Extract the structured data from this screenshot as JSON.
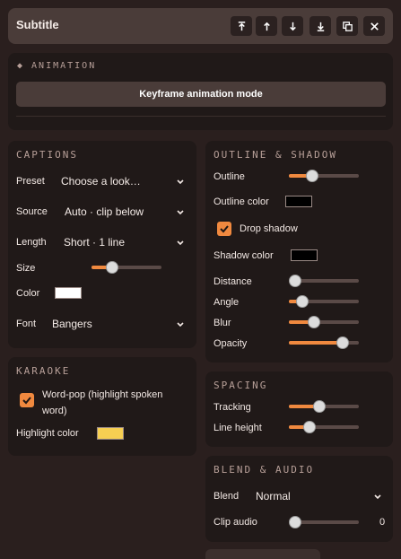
{
  "header": {
    "title": "Subtitle",
    "buttons": [
      "move-to-top-icon",
      "move-up-icon",
      "move-down-icon",
      "move-to-bottom-icon",
      "duplicate-icon",
      "close-icon"
    ]
  },
  "animation": {
    "title": "◆ ANIMATION",
    "button_label": "Keyframe animation mode"
  },
  "captions": {
    "title": "CAPTIONS",
    "preset_label": "Preset",
    "preset_value": "Choose a look…",
    "source_label": "Source",
    "source_value": "Auto · clip below",
    "length_label": "Length",
    "length_value": "Short · 1 line",
    "size_label": "Size",
    "size_level": 0.3,
    "color_label": "Color",
    "color_value": "#ffffff",
    "font_label": "Font",
    "font_value": "Bangers"
  },
  "karaoke": {
    "title": "KARAOKE",
    "wordpop_label": "Word-pop (highlight spoken word)",
    "wordpop_checked": true,
    "highlight_label": "Highlight color",
    "highlight_color": "#f6cf52"
  },
  "outline_shadow": {
    "title": "OUTLINE & SHADOW",
    "outline_label": "Outline",
    "outline_level": 0.33,
    "outline_color_label": "Outline color",
    "outline_color": "#000000",
    "drop_shadow_label": "Drop shadow",
    "drop_shadow_checked": true,
    "shadow_color_label": "Shadow color",
    "shadow_color": "#000000",
    "distance_label": "Distance",
    "distance_level": 0.08,
    "angle_label": "Angle",
    "angle_level": 0.19,
    "blur_label": "Blur",
    "blur_level": 0.36,
    "opacity_label": "Opacity",
    "opacity_level": 0.77
  },
  "spacing": {
    "title": "SPACING",
    "tracking_label": "Tracking",
    "tracking_level": 0.43,
    "line_height_label": "Line height",
    "line_height_level": 0.29
  },
  "blend_audio": {
    "title": "BLEND & AUDIO",
    "blend_label": "Blend",
    "blend_value": "Normal",
    "clip_audio_label": "Clip audio",
    "clip_audio_value": "0",
    "clip_audio_level": 0.0
  },
  "colors": {
    "accent": "#f0893f",
    "panel": "#201918",
    "background": "#2a1f1e"
  }
}
